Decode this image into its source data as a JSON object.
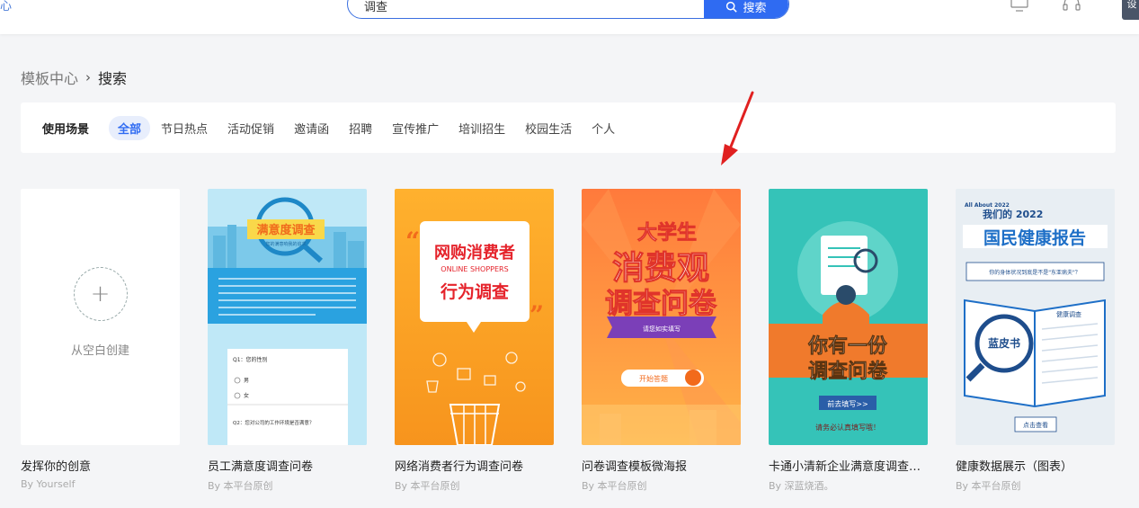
{
  "header": {
    "corner_text": "心",
    "search_value": "调查",
    "search_button": "搜索",
    "user_chip": "设"
  },
  "breadcrumb": {
    "root": "模板中心",
    "separator": "›",
    "current": "搜索"
  },
  "filters": {
    "label": "使用场景",
    "items": [
      "全部",
      "节日热点",
      "活动促销",
      "邀请函",
      "招聘",
      "宣传推广",
      "培训招生",
      "校园生活",
      "个人"
    ],
    "active_index": 0
  },
  "blank_card": {
    "text": "从空白创建",
    "title": "发挥你的创意",
    "author": "By Yourself"
  },
  "templates": [
    {
      "title": "员工满意度调查问卷",
      "author": "By 本平台原创",
      "poster_heading": "满意度调查",
      "poster_sub": "您的满意响我的追求",
      "q1": "Q1：您的性别",
      "opt1": "男",
      "opt2": "女",
      "q2": "Q2：您对公司的工作环境是否满意？"
    },
    {
      "title": "网络消费者行为调查问卷",
      "author": "By 本平台原创",
      "poster_line1": "网购消费者",
      "poster_line2": "ONLINE SHOPPERS",
      "poster_line3": "行为调查"
    },
    {
      "title": "问卷调查模板微海报",
      "author": "By 本平台原创",
      "poster_line1": "大学生",
      "poster_line2": "消费观",
      "poster_line3": "调查问卷",
      "poster_ribbon": "请您如实填写",
      "poster_button": "开始答题"
    },
    {
      "title": "卡通小清新企业满意度调查问卷",
      "author": "By 深蓝烧酒。",
      "poster_line1": "你有一份",
      "poster_line2": "调查问卷",
      "poster_button": "前去填写>>",
      "poster_footer": "请务必认真填写哦！"
    },
    {
      "title": "健康数据展示（图表）",
      "author": "By 本平台原创",
      "poster_top": "All About 2022",
      "poster_year": "我们的 2022",
      "poster_heading": "国民健康报告",
      "poster_question": "你的身体状况到底是不是\"东亚病夫\"？",
      "poster_badge": "蓝皮书",
      "poster_page_label": "健康调查",
      "poster_button": "点击查看"
    }
  ],
  "colors": {
    "accent": "#2f6bf2",
    "arrow": "#e02020"
  }
}
